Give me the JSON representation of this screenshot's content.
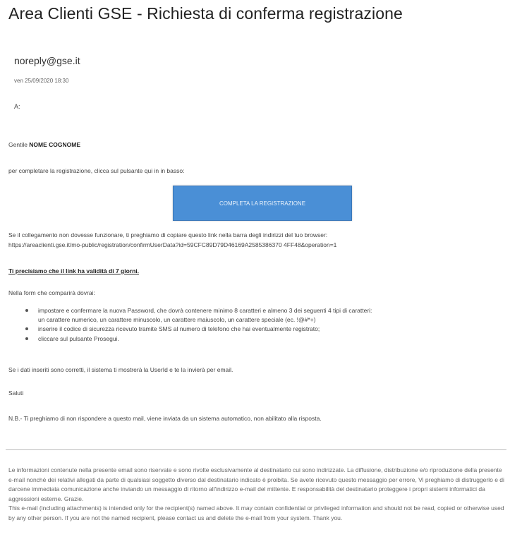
{
  "email": {
    "subject": "Area Clienti GSE - Richiesta di conferma registrazione",
    "sender": "noreply@gse.it",
    "date": "ven 25/09/2020 18:30",
    "recipient": "A:"
  },
  "body": {
    "greeting_prefix": "Gentile ",
    "greeting_name": "NOME COGNOME",
    "intro": "per completare la registrazione, clicca sul pulsante qui in in basso:",
    "button_label": "COMPLETA LA REGISTRAZIONE",
    "fallback_text": "Se il collegamento non dovesse funzionare, ti preghiamo di copiare questo link nella barra degli indirizzi del tuo browser:",
    "fallback_url": "https://areaclienti.gse.it/mo-public/registration/confirmUserData?id=59CFC89D79D46169A2585386370 4FF48&operation=1",
    "validity_note": "Ti precisiamo che il link ha validità di 7 giorni.",
    "form_intro": "Nella form che comparirà dovrai:",
    "bullets": [
      "impostare e confermare la nuova Password, che dovrà contenere minimo 8 caratteri e almeno 3 dei seguenti 4 tipi di caratteri:",
      "un carattere numerico, un carattere minuscolo, un carattere maiuscolo, un carattere speciale (ec. !@#*+)",
      "inserire il codice di sicurezza ricevuto tramite SMS al numero di telefono che hai eventualmente registrato;",
      "cliccare sul pulsante Prosegui."
    ],
    "data_correct": "Se i dati inseriti sono corretti, il sistema ti mostrerà la UserId e te la invierà per email.",
    "regards": "Saluti",
    "nb": "N.B.- Ti preghiamo di non rispondere a questo mail, viene inviata da un sistema automatico, non abilitato alla risposta."
  },
  "disclaimer": {
    "it": "Le informazioni contenute nella presente email sono riservate e sono rivolte esclusivamente al destinatario cui sono indirizzate. La diffusione, distribuzione e/o riproduzione della presente e-mail nonché dei relativi allegati da parte di qualsiasi soggetto diverso dal destinatario indicato è proibita. Se avete ricevuto questo messaggio per errore, Vi preghiamo di distruggerlo e di darcene immediata comunicazione anche inviando un messaggio di ritorno all'indirizzo e-mail del mittente. E responsabilità del destinatario proteggere i propri sistemi informatici da aggressioni esterne. Grazie.",
    "en": "This e-mail (including attachments) is intended only for the recipient(s) named above. It may contain confidential or privileged information and should not be read, copied or otherwise used by any other person. If you are not the named recipient, please contact us and delete the e-mail from your system. Thank you."
  },
  "colors": {
    "button_bg": "#4a8fd6",
    "button_text": "#eaf2fb",
    "divider": "#bdbdbd"
  }
}
